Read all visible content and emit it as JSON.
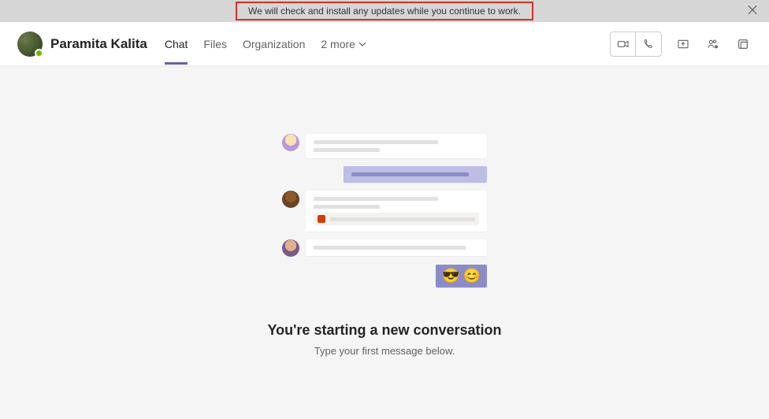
{
  "banner": {
    "text": "We will check and install any updates while you continue to work."
  },
  "user": {
    "name": "Paramita Kalita"
  },
  "tabs": {
    "chat": "Chat",
    "files": "Files",
    "organization": "Organization",
    "more": "2 more"
  },
  "illustration": {
    "emoji_cool": "😎",
    "emoji_smile": "😊"
  },
  "empty_state": {
    "title": "You're starting a new conversation",
    "subtitle": "Type your first message below."
  }
}
